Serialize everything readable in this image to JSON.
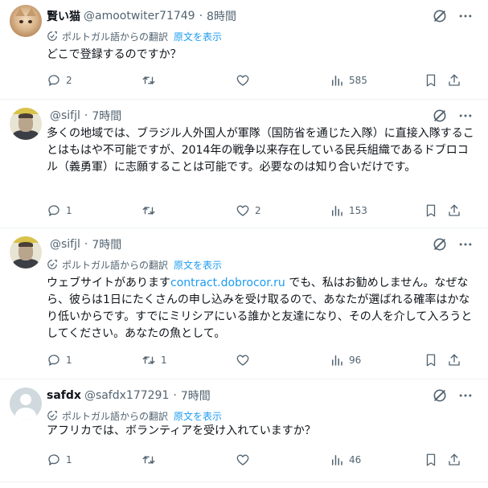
{
  "translation_label": "ポルトガル語からの翻訳",
  "show_original": "原文を表示",
  "tweets": [
    {
      "name": "賢い猫",
      "handle": "@amootwiter71749",
      "time": "8時間",
      "text": "どこで登録するのですか？",
      "replies": "2",
      "retweets": "",
      "likes": "",
      "views": "585"
    },
    {
      "name": "",
      "handle": "@sifjl",
      "time": "7時間",
      "text": "多くの地域では、ブラジル人外国人が軍隊（国防省を通じた入隊）に直接入隊することはもはや不可能ですが、2014年の戦争以来存在している民兵組織であるドブロコル（義勇軍）に志願することは可能です。必要なのは知り合いだけです。",
      "replies": "1",
      "retweets": "",
      "likes": "2",
      "views": "153"
    },
    {
      "name": "",
      "handle": "@sifjl",
      "time": "7時間",
      "text_before": "ウェブサイトがあります",
      "link": "contract.dobrocor.ru",
      "text_after": " でも、私はお勧めしません。なぜなら、彼らは1日にたくさんの申し込みを受け取るので、あなたが選ばれる確率はかなり低いからです。すでにミリシアにいる誰かと友達になり、その人を介して入ろうとしてください。あなたの魚として。",
      "replies": "1",
      "retweets": "1",
      "likes": "",
      "views": "96"
    },
    {
      "name": "safdx",
      "handle": "@safdx177291",
      "time": "7時間",
      "text": "アフリカでは、ボランティアを受け入れていますか？",
      "replies": "1",
      "retweets": "",
      "likes": "",
      "views": "46"
    }
  ]
}
